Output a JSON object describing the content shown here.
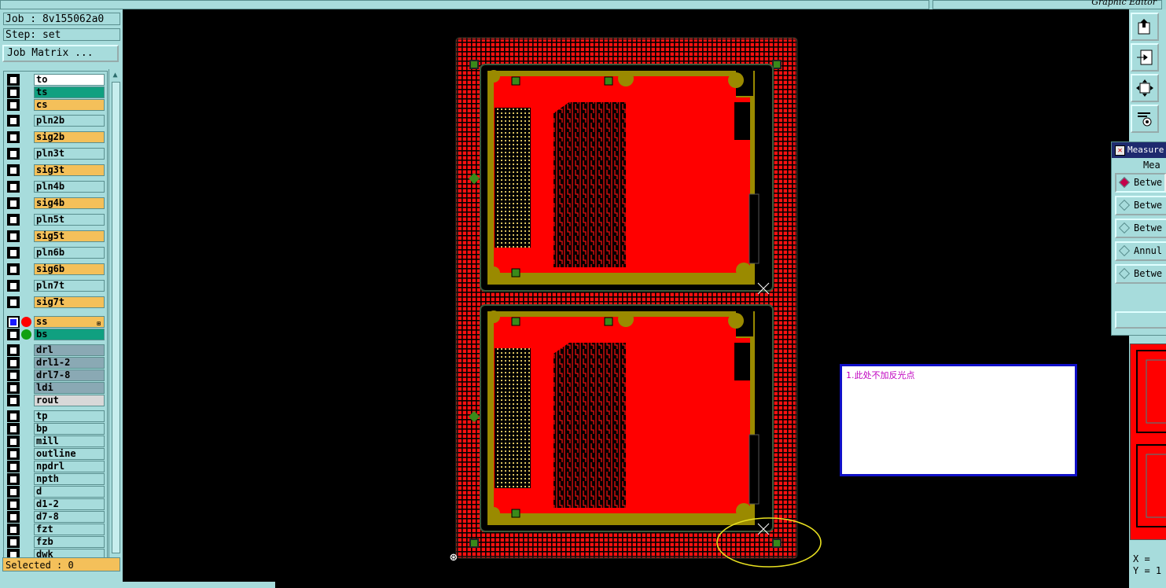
{
  "window": {
    "title": "Graphic Editor"
  },
  "info": {
    "job": "Job : 8v155062a0",
    "step": "Step: set"
  },
  "job_matrix_label": "Job Matrix ...",
  "layers": [
    {
      "name": "to",
      "color": "#ffffff"
    },
    {
      "name": "ts",
      "color": "#10a080"
    },
    {
      "name": "cs",
      "color": "#f4c05a"
    },
    {
      "name": "pln2b",
      "color": "#a7dcdc"
    },
    {
      "name": "sig2b",
      "color": "#f4c05a"
    },
    {
      "name": "pln3t",
      "color": "#a7dcdc"
    },
    {
      "name": "sig3t",
      "color": "#f4c05a"
    },
    {
      "name": "pln4b",
      "color": "#a7dcdc"
    },
    {
      "name": "sig4b",
      "color": "#f4c05a"
    },
    {
      "name": "pln5t",
      "color": "#a7dcdc"
    },
    {
      "name": "sig5t",
      "color": "#f4c05a"
    },
    {
      "name": "pln6b",
      "color": "#a7dcdc"
    },
    {
      "name": "sig6b",
      "color": "#f4c05a"
    },
    {
      "name": "pln7t",
      "color": "#a7dcdc"
    },
    {
      "name": "sig7t",
      "color": "#f4c05a"
    },
    {
      "name": "ss",
      "color": "#f4c05a",
      "display": "#ff0000",
      "work": true
    },
    {
      "name": "bs",
      "color": "#10a080",
      "display": "#10a010"
    },
    {
      "name": "drl",
      "color": "#8aa9b4"
    },
    {
      "name": "drl1-2",
      "color": "#8aa9b4"
    },
    {
      "name": "drl7-8",
      "color": "#8aa9b4"
    },
    {
      "name": "ldi",
      "color": "#8aa9b4"
    },
    {
      "name": "rout",
      "color": "#d8d8d8"
    },
    {
      "name": "tp",
      "color": "#a7dcdc"
    },
    {
      "name": "bp",
      "color": "#a7dcdc"
    },
    {
      "name": "mill",
      "color": "#a7dcdc"
    },
    {
      "name": "outline",
      "color": "#a7dcdc"
    },
    {
      "name": "npdrl",
      "color": "#a7dcdc"
    },
    {
      "name": "npth",
      "color": "#a7dcdc"
    },
    {
      "name": "d",
      "color": "#a7dcdc"
    },
    {
      "name": "d1-2",
      "color": "#a7dcdc"
    },
    {
      "name": "d7-8",
      "color": "#a7dcdc"
    },
    {
      "name": "fzt",
      "color": "#a7dcdc"
    },
    {
      "name": "fzb",
      "color": "#a7dcdc"
    },
    {
      "name": "dwk",
      "color": "#a7dcdc"
    }
  ],
  "selected_text": "Selected : 0",
  "toolbar": {
    "icons": [
      "export-icon",
      "import-icon",
      "fit-view-icon",
      "tools-icon"
    ]
  },
  "measure": {
    "title": "Measure",
    "header": "Mea",
    "options": [
      {
        "label": "Betwe",
        "active": true
      },
      {
        "label": "Betwe",
        "active": false
      },
      {
        "label": "Betwe",
        "active": false
      },
      {
        "label": "Annul",
        "active": false
      },
      {
        "label": "Betwe",
        "active": false
      }
    ]
  },
  "coords": {
    "x": "X = ",
    "y": "Y = 1"
  },
  "note": {
    "text": "1.此处不加反光点"
  },
  "colors": {
    "board_red": "#ff0000",
    "frame_olive": "#9a8a00",
    "fiducial_green": "#3a8a1a",
    "annotation_yellow": "#e8e020"
  }
}
